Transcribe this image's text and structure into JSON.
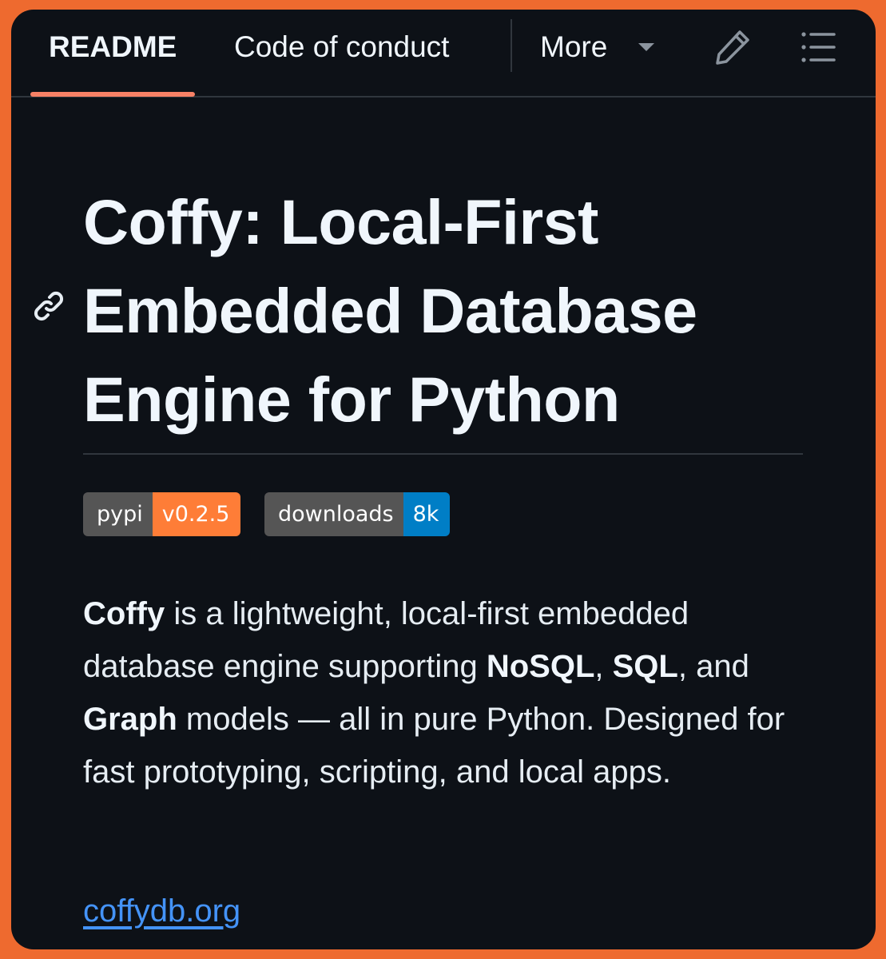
{
  "tabs": {
    "readme": "README",
    "code_of_conduct": "Code of conduct",
    "more": "More"
  },
  "icons": {
    "edit": "pencil-icon",
    "outline": "list-icon",
    "anchor": "link-icon",
    "more_caret": "caret-down-icon"
  },
  "heading": {
    "line1": "Coffy: Local-First",
    "line2": "Embedded Database",
    "line3": "Engine for Python"
  },
  "badges": {
    "pypi": {
      "label": "pypi",
      "value": "v0.2.5",
      "color": "#FE7D37"
    },
    "downloads": {
      "label": "downloads",
      "value": "8k",
      "color": "#007EC6"
    }
  },
  "description": {
    "part1_bold": "Coffy",
    "part2": " is a lightweight, local-first embedded database engine supporting ",
    "part3_bold": "NoSQL",
    "part4": ", ",
    "part5_bold": "SQL",
    "part6": ", and ",
    "part7_bold": "Graph",
    "part8": " models — all in pure Python. Designed for fast prototyping, scripting, and local apps."
  },
  "website": {
    "text": "coffydb.org"
  },
  "colors": {
    "frame_border": "#EE6A2F",
    "background": "#0D1117",
    "active_tab_underline": "#F78166",
    "link": "#4493F8"
  }
}
